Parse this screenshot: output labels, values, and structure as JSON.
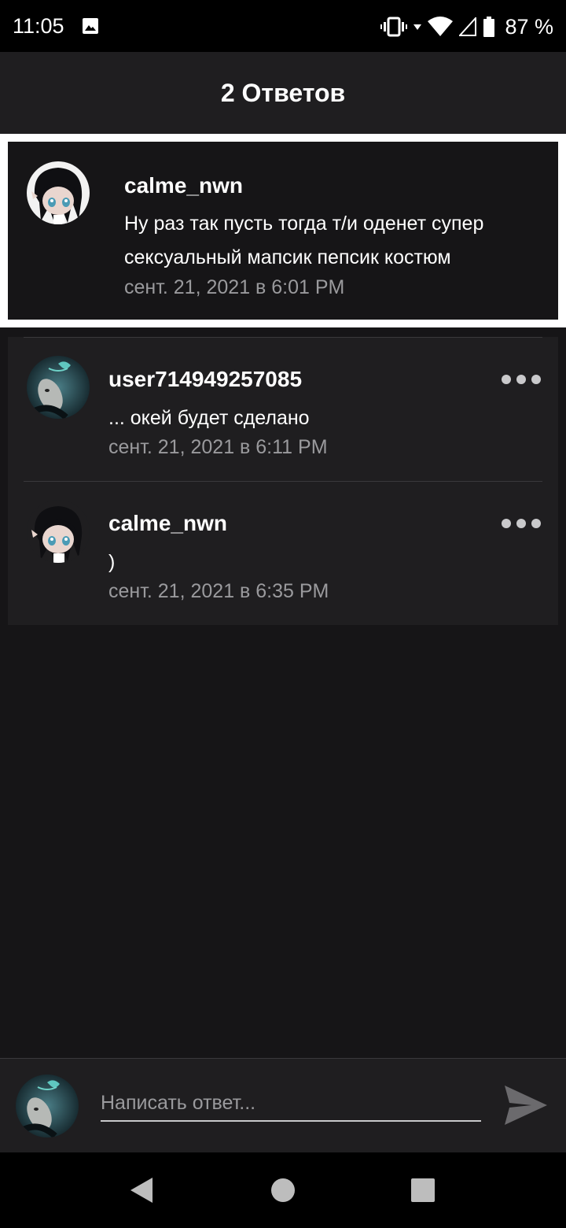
{
  "status_bar": {
    "time": "11:05",
    "battery": "87 %",
    "icons": [
      "image-icon",
      "vibrate-icon",
      "wifi-icon",
      "signal-icon",
      "battery-icon"
    ]
  },
  "header": {
    "title": "2 Ответов"
  },
  "parent_comment": {
    "username": "calme_nwn",
    "text_line1": "Ну раз так пусть тогда т/и оденет супер",
    "text_line2": "сексуальный мапсик пепсик костюм",
    "timestamp": "сент. 21, 2021 в 6:01 PM"
  },
  "replies": [
    {
      "username": "user714949257085",
      "text": "... окей будет сделано",
      "timestamp": "сент. 21, 2021 в 6:11 PM"
    },
    {
      "username": "calme_nwn",
      "text": ")",
      "timestamp": "сент. 21, 2021 в 6:35 PM"
    }
  ],
  "composer": {
    "placeholder": "Написать ответ..."
  },
  "colors": {
    "background": "#161517",
    "card": "#1f1e20",
    "muted_text": "#9a9a9d",
    "highlight_border": "#ffffff"
  }
}
